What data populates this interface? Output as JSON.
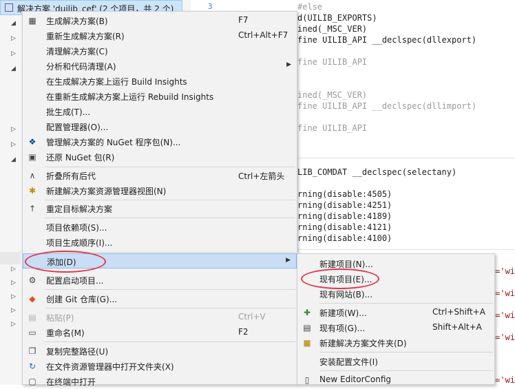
{
  "explorer": {
    "title": "解决方案 'duilib_cef' (2 个项目，共 2 个)"
  },
  "editor": {
    "line_number": "3",
    "lines_top": [
      {
        "text": "#else",
        "style": "gray"
      },
      {
        "text": "d(UILIB_EXPORTS)",
        "style": "mac"
      },
      {
        "text": "ined(_MSC_VER)",
        "style": "mac"
      },
      {
        "text": "fine UILIB_API __declspec(dllexport)",
        "style": "kw"
      },
      {
        "text": "",
        "style": ""
      },
      {
        "text": "fine UILIB_API",
        "style": "gray"
      },
      {
        "text": "",
        "style": ""
      },
      {
        "text": "",
        "style": ""
      },
      {
        "text": "ined(_MSC_VER)",
        "style": "gray"
      },
      {
        "text": "fine UILIB_API __declspec(dllimport)",
        "style": "gray"
      },
      {
        "text": "",
        "style": ""
      },
      {
        "text": "fine UILIB_API",
        "style": "gray"
      }
    ],
    "comdat": "LIB_COMDAT __declspec(selectany)",
    "warnings": [
      "rning(disable:4505)",
      "rning(disable:4251)",
      "rning(disable:4189)",
      "rning(disable:4121)",
      "rning(disable:4100)"
    ],
    "right_strings": [
      "='wi",
      "='wi",
      "='wi",
      "='wi",
      "='wi"
    ]
  },
  "menu": {
    "items": [
      {
        "label": "生成解决方案(B)",
        "shortcut": "F7",
        "icon": "build-icon"
      },
      {
        "label": "重新生成解决方案(R)",
        "shortcut": "Ctrl+Alt+F7",
        "icon": ""
      },
      {
        "label": "清理解决方案(C)",
        "shortcut": "",
        "icon": ""
      },
      {
        "label": "分析和代码清理(A)",
        "shortcut": "",
        "icon": "",
        "submenu": true
      },
      {
        "label": "在生成解决方案上运行 Build Insights",
        "shortcut": "",
        "icon": ""
      },
      {
        "label": "在重新生成解决方案上运行 Rebuild Insights",
        "shortcut": "",
        "icon": ""
      },
      {
        "label": "批生成(T)...",
        "shortcut": "",
        "icon": ""
      },
      {
        "label": "配置管理器(O)...",
        "shortcut": "",
        "icon": ""
      },
      {
        "label": "管理解决方案的 NuGet 程序包(N)...",
        "shortcut": "",
        "icon": "nuget-icon"
      },
      {
        "label": "还原 NuGet 包(R)",
        "shortcut": "",
        "icon": "restore-icon"
      },
      {
        "label": "折叠所有后代",
        "shortcut": "Ctrl+左箭头",
        "icon": "collapse-icon"
      },
      {
        "label": "新建解决方案资源管理器视图(N)",
        "shortcut": "",
        "icon": "new-view-icon"
      },
      {
        "label": "重定目标解决方案",
        "shortcut": "",
        "icon": "retarget-icon"
      },
      {
        "label": "项目依赖项(S)...",
        "shortcut": "",
        "icon": ""
      },
      {
        "label": "项目生成顺序(I)...",
        "shortcut": "",
        "icon": ""
      },
      {
        "label": "添加(D)",
        "shortcut": "",
        "icon": "",
        "submenu": true
      },
      {
        "label": "配置启动项目...",
        "shortcut": "",
        "icon": "gear-icon"
      },
      {
        "label": "创建 Git 仓库(G)...",
        "shortcut": "",
        "icon": "git-icon"
      },
      {
        "label": "粘贴(P)",
        "shortcut": "Ctrl+V",
        "icon": "paste-icon",
        "disabled": true
      },
      {
        "label": "重命名(M)",
        "shortcut": "F2",
        "icon": "rename-icon"
      },
      {
        "label": "复制完整路径(U)",
        "shortcut": "",
        "icon": "copy-icon"
      },
      {
        "label": "在文件资源管理器中打开文件夹(X)",
        "shortcut": "",
        "icon": "refresh-icon"
      },
      {
        "label": "在终端中打开",
        "shortcut": "",
        "icon": "terminal-icon"
      }
    ]
  },
  "submenu": {
    "items": [
      {
        "label": "新建项目(N)...",
        "shortcut": "",
        "icon": ""
      },
      {
        "label": "现有项目(E)...",
        "shortcut": "",
        "icon": ""
      },
      {
        "label": "现有网站(B)...",
        "shortcut": "",
        "icon": ""
      },
      {
        "label": "新建项(W)...",
        "shortcut": "Ctrl+Shift+A",
        "icon": "new-item-icon"
      },
      {
        "label": "现有项(G)...",
        "shortcut": "Shift+Alt+A",
        "icon": "existing-item-icon"
      },
      {
        "label": "新建解决方案文件夹(D)",
        "shortcut": "",
        "icon": "folder-icon"
      },
      {
        "label": "安装配置文件(I)",
        "shortcut": "",
        "icon": ""
      },
      {
        "label": "New EditorConfig",
        "shortcut": "",
        "icon": "editorconfig-icon"
      }
    ]
  },
  "colors": {
    "highlight": "#c9def5",
    "annotation": "#e0384e"
  }
}
